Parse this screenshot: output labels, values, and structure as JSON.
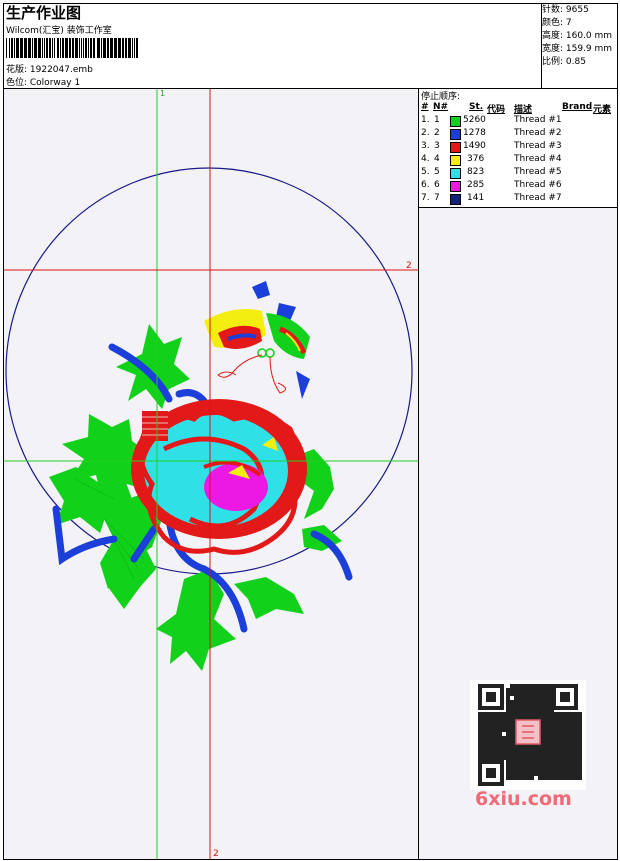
{
  "header": {
    "title": "生产作业图",
    "subtitle": "Wilcom(汇宝) 装饰工作室",
    "design_label": "花版: 1922047.emb",
    "colorway_label": "色位: Colorway 1"
  },
  "stats": {
    "stitches": "针数: 9655",
    "colors": "颜色: 7",
    "height": "高度: 160.0 mm",
    "width": "宽度: 159.9 mm",
    "scale": "比例: 0.85"
  },
  "stop_sequence": {
    "title": "停止顺序:",
    "columns": [
      "#",
      "N#",
      "St.",
      "代码",
      "描述",
      "Brand",
      "元素"
    ],
    "rows": [
      {
        "idx": "1.",
        "n": "1",
        "color": "#11d11a",
        "st": "5260",
        "desc": "Thread #1"
      },
      {
        "idx": "2.",
        "n": "2",
        "color": "#1b3fd8",
        "st": "1278",
        "desc": "Thread #2"
      },
      {
        "idx": "3.",
        "n": "3",
        "color": "#e31818",
        "st": "1490",
        "desc": "Thread #3"
      },
      {
        "idx": "4.",
        "n": "4",
        "color": "#f4ee10",
        "st": "376",
        "desc": "Thread #4"
      },
      {
        "idx": "5.",
        "n": "5",
        "color": "#2fe0e6",
        "st": "823",
        "desc": "Thread #5"
      },
      {
        "idx": "6.",
        "n": "6",
        "color": "#ec19e4",
        "st": "285",
        "desc": "Thread #6"
      },
      {
        "idx": "7.",
        "n": "7",
        "color": "#142277",
        "st": "141",
        "desc": "Thread #7"
      }
    ]
  },
  "guides": {
    "v_green_label": "1",
    "h_red_label": "2",
    "v_red_label": "2"
  },
  "watermark": {
    "brand": "6xiu.com"
  },
  "colors": {
    "green": "#11d11a",
    "blue": "#1b3fd8",
    "red": "#e31818",
    "yellow": "#f4ee10",
    "cyan": "#2fe0e6",
    "magenta": "#ec19e4",
    "navy": "#142277",
    "hoop": "#1a1a8a",
    "canvas": "#f3f2f6"
  }
}
